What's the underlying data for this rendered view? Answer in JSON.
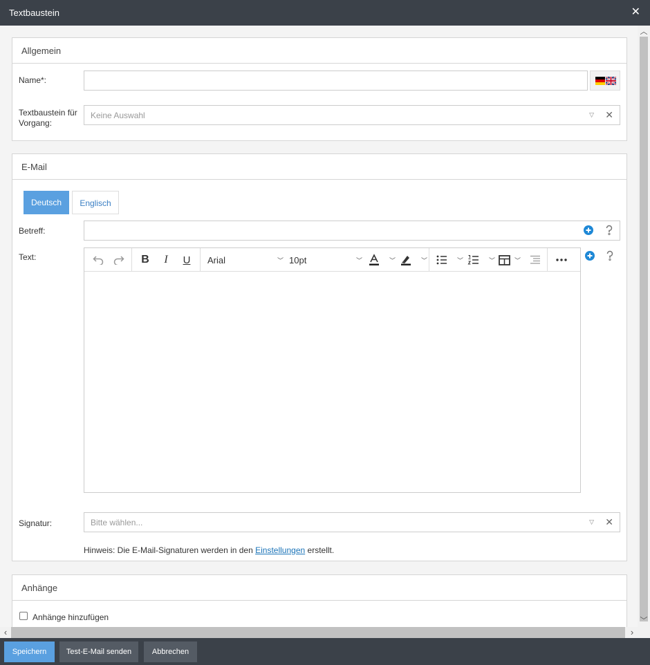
{
  "dialog": {
    "title": "Textbaustein"
  },
  "allgemein": {
    "heading": "Allgemein",
    "name_label": "Name*:",
    "name_value": "",
    "vorgang_label_line1": "Textbaustein für",
    "vorgang_label_line2": "Vorgang:",
    "vorgang_placeholder": "Keine Auswahl"
  },
  "email": {
    "heading": "E-Mail",
    "tabs": [
      {
        "label": "Deutsch",
        "active": true
      },
      {
        "label": "Englisch",
        "active": false
      }
    ],
    "betreff_label": "Betreff:",
    "betreff_value": "",
    "text_label": "Text:",
    "editor": {
      "font": "Arial",
      "size": "10pt"
    },
    "signatur_label": "Signatur:",
    "signatur_placeholder": "Bitte wählen...",
    "hint_prefix": "Hinweis: Die E-Mail-Signaturen werden in den ",
    "hint_link": "Einstellungen",
    "hint_suffix": " erstellt."
  },
  "anhaenge": {
    "heading": "Anhänge",
    "checkbox_label": "Anhänge hinzufügen",
    "checked": false
  },
  "footer": {
    "save": "Speichern",
    "test": "Test-E-Mail senden",
    "cancel": "Abbrechen"
  },
  "colors": {
    "titlebar": "#3b4149",
    "accent": "#5aa0e0",
    "link": "#1a73b8",
    "add_icon": "#1e88d6"
  },
  "icons": [
    "close-icon",
    "de-flag-icon",
    "uk-flag-icon",
    "dropdown-icon",
    "clear-icon",
    "add-circle-icon",
    "help-icon",
    "undo-icon",
    "redo-icon",
    "bold-icon",
    "italic-icon",
    "underline-icon",
    "font-color-icon",
    "highlight-icon",
    "bullet-list-icon",
    "numbered-list-icon",
    "table-icon",
    "indent-icon",
    "more-icon"
  ]
}
